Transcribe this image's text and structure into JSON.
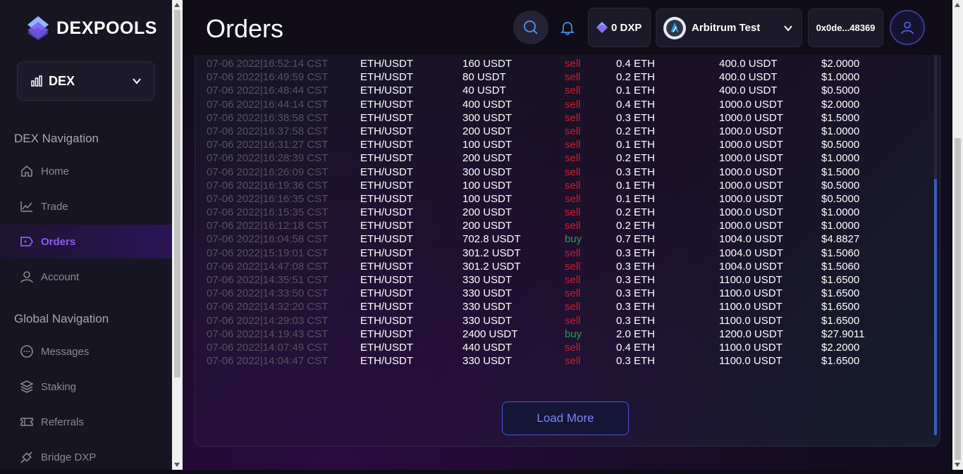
{
  "brand": {
    "name": "DEXPOOLS"
  },
  "dex_selector": {
    "label": "DEX"
  },
  "sidebar": {
    "dex_nav_title": "DEX Navigation",
    "dex_items": [
      {
        "label": "Home",
        "icon": "home-icon"
      },
      {
        "label": "Trade",
        "icon": "trend-icon"
      },
      {
        "label": "Orders",
        "icon": "orders-icon",
        "active": true
      },
      {
        "label": "Account",
        "icon": "user-icon"
      }
    ],
    "global_nav_title": "Global Navigation",
    "global_items": [
      {
        "label": "Messages",
        "icon": "chat-icon"
      },
      {
        "label": "Staking",
        "icon": "layers-icon"
      },
      {
        "label": "Referrals",
        "icon": "ticket-icon"
      },
      {
        "label": "Bridge DXP",
        "icon": "plug-icon"
      }
    ]
  },
  "header": {
    "title": "Orders",
    "balance": "0 DXP",
    "network": "Arbitrum Test",
    "address": "0x0de...48369"
  },
  "orders": [
    [
      "07-06 2022|16:52:14 CST",
      "ETH/USDT",
      "160 USDT",
      "sell",
      "0.4 ETH",
      "400.0 USDT",
      "$2.0000"
    ],
    [
      "07-06 2022|16:49:59 CST",
      "ETH/USDT",
      "80 USDT",
      "sell",
      "0.2 ETH",
      "400.0 USDT",
      "$1.0000"
    ],
    [
      "07-06 2022|16:48:44 CST",
      "ETH/USDT",
      "40 USDT",
      "sell",
      "0.1 ETH",
      "400.0 USDT",
      "$0.5000"
    ],
    [
      "07-06 2022|16:44:14 CST",
      "ETH/USDT",
      "400 USDT",
      "sell",
      "0.4 ETH",
      "1000.0 USDT",
      "$2.0000"
    ],
    [
      "07-06 2022|16:38:58 CST",
      "ETH/USDT",
      "300 USDT",
      "sell",
      "0.3 ETH",
      "1000.0 USDT",
      "$1.5000"
    ],
    [
      "07-06 2022|16:37:58 CST",
      "ETH/USDT",
      "200 USDT",
      "sell",
      "0.2 ETH",
      "1000.0 USDT",
      "$1.0000"
    ],
    [
      "07-06 2022|16:31:27 CST",
      "ETH/USDT",
      "100 USDT",
      "sell",
      "0.1 ETH",
      "1000.0 USDT",
      "$0.5000"
    ],
    [
      "07-06 2022|16:28:39 CST",
      "ETH/USDT",
      "200 USDT",
      "sell",
      "0.2 ETH",
      "1000.0 USDT",
      "$1.0000"
    ],
    [
      "07-06 2022|16:26:09 CST",
      "ETH/USDT",
      "300 USDT",
      "sell",
      "0.3 ETH",
      "1000.0 USDT",
      "$1.5000"
    ],
    [
      "07-06 2022|16:19:36 CST",
      "ETH/USDT",
      "100 USDT",
      "sell",
      "0.1 ETH",
      "1000.0 USDT",
      "$0.5000"
    ],
    [
      "07-06 2022|16:16:35 CST",
      "ETH/USDT",
      "100 USDT",
      "sell",
      "0.1 ETH",
      "1000.0 USDT",
      "$0.5000"
    ],
    [
      "07-06 2022|16:15:35 CST",
      "ETH/USDT",
      "200 USDT",
      "sell",
      "0.2 ETH",
      "1000.0 USDT",
      "$1.0000"
    ],
    [
      "07-06 2022|16:12:18 CST",
      "ETH/USDT",
      "200 USDT",
      "sell",
      "0.2 ETH",
      "1000.0 USDT",
      "$1.0000"
    ],
    [
      "07-06 2022|16:04:58 CST",
      "ETH/USDT",
      "702.8 USDT",
      "buy",
      "0.7 ETH",
      "1004.0 USDT",
      "$4.8827"
    ],
    [
      "07-06 2022|15:19:01 CST",
      "ETH/USDT",
      "301.2 USDT",
      "sell",
      "0.3 ETH",
      "1004.0 USDT",
      "$1.5060"
    ],
    [
      "07-06 2022|14:47:08 CST",
      "ETH/USDT",
      "301.2 USDT",
      "sell",
      "0.3 ETH",
      "1004.0 USDT",
      "$1.5060"
    ],
    [
      "07-06 2022|14:35:51 CST",
      "ETH/USDT",
      "330 USDT",
      "sell",
      "0.3 ETH",
      "1100.0 USDT",
      "$1.6500"
    ],
    [
      "07-06 2022|14:33:50 CST",
      "ETH/USDT",
      "330 USDT",
      "sell",
      "0.3 ETH",
      "1100.0 USDT",
      "$1.6500"
    ],
    [
      "07-06 2022|14:32:20 CST",
      "ETH/USDT",
      "330 USDT",
      "sell",
      "0.3 ETH",
      "1100.0 USDT",
      "$1.6500"
    ],
    [
      "07-06 2022|14:29:03 CST",
      "ETH/USDT",
      "330 USDT",
      "sell",
      "0.3 ETH",
      "1100.0 USDT",
      "$1.6500"
    ],
    [
      "07-06 2022|14:19:43 CST",
      "ETH/USDT",
      "2400 USDT",
      "buy",
      "2.0 ETH",
      "1200.0 USDT",
      "$27.9011"
    ],
    [
      "07-06 2022|14:07:49 CST",
      "ETH/USDT",
      "440 USDT",
      "sell",
      "0.4 ETH",
      "1100.0 USDT",
      "$2.2000"
    ],
    [
      "07-06 2022|14:04:47 CST",
      "ETH/USDT",
      "330 USDT",
      "sell",
      "0.3 ETH",
      "1100.0 USDT",
      "$1.6500"
    ]
  ],
  "load_more_label": "Load More",
  "colors": {
    "accent": "#8b5cf6",
    "sell": "#d11a2a",
    "buy": "#1ea64b",
    "button_border": "#4f55d8"
  }
}
